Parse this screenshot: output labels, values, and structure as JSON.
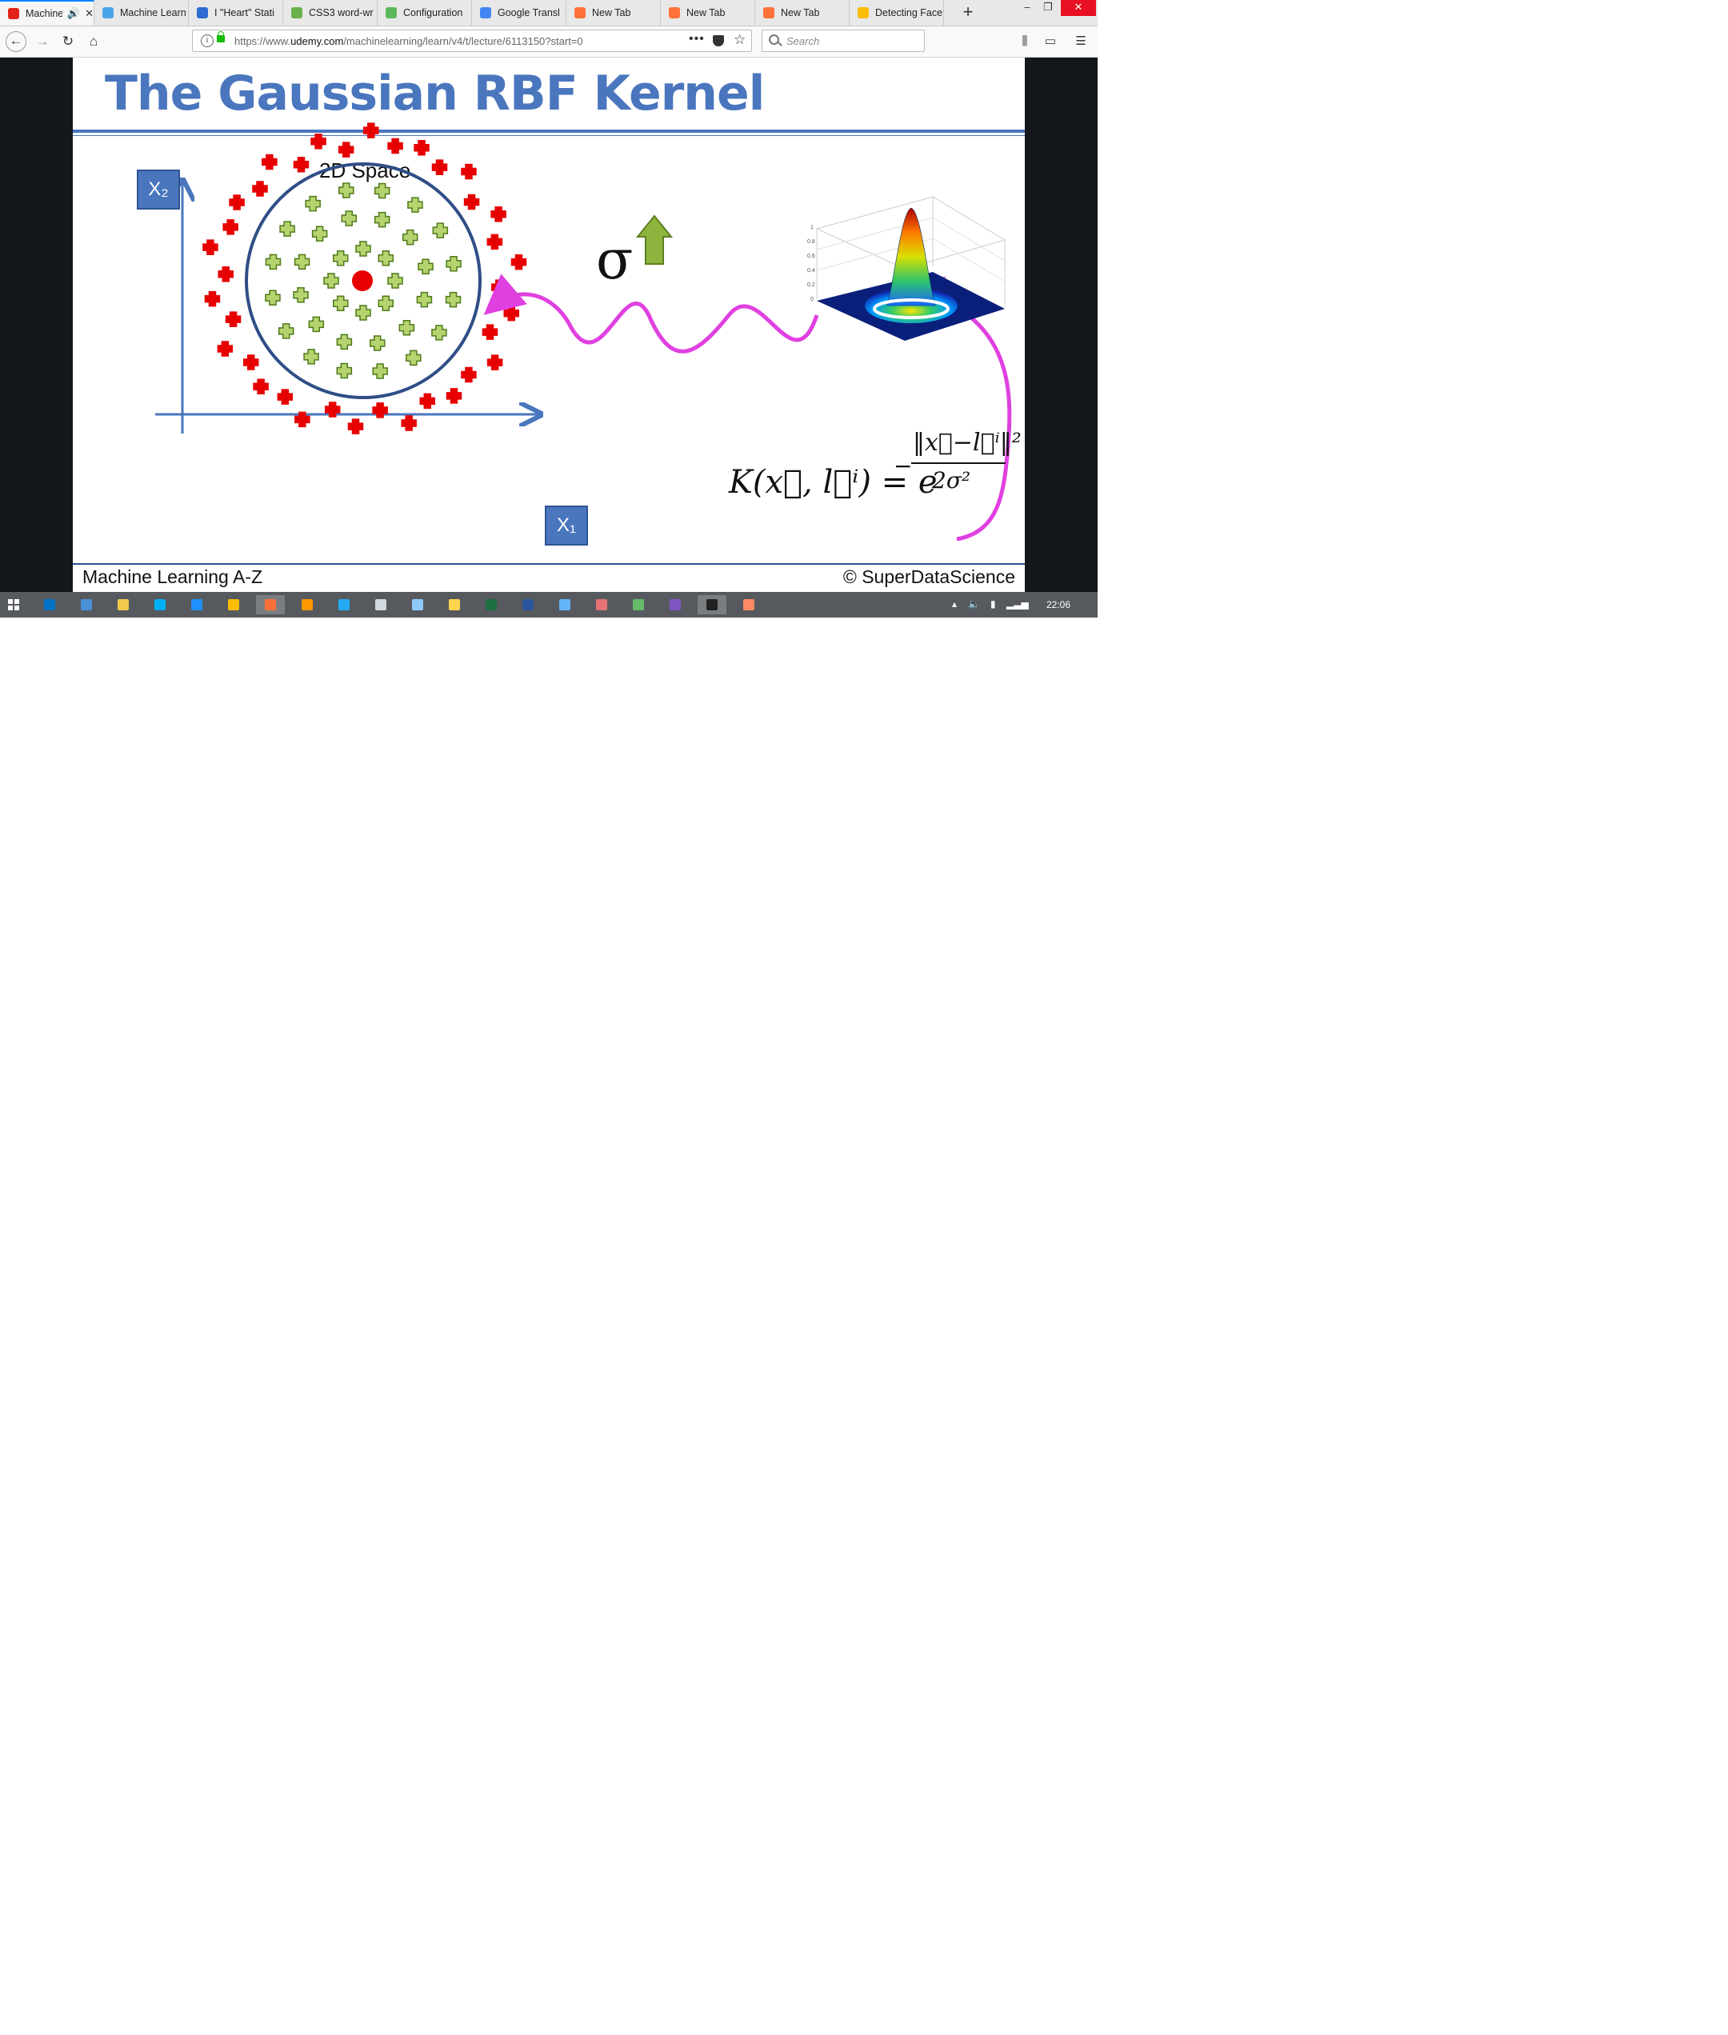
{
  "browser": {
    "tabs": [
      {
        "title": "Machine",
        "color": "#e2231a"
      },
      {
        "title": "Machine Learn",
        "color": "#4aa5e8"
      },
      {
        "title": "I \"Heart\" Stati",
        "color": "#2d6bd0"
      },
      {
        "title": "CSS3 word-wr",
        "color": "#6ab04c"
      },
      {
        "title": "Configuration",
        "color": "#5cb85c"
      },
      {
        "title": "Google Transl",
        "color": "#4285f4"
      },
      {
        "title": "New Tab",
        "color": "#ff7139"
      },
      {
        "title": "New Tab",
        "color": "#ff7139"
      },
      {
        "title": "New Tab",
        "color": "#ff7139"
      },
      {
        "title": "Detecting Face",
        "color": "#fbbc05"
      }
    ],
    "new_tab_label": "+",
    "window_controls": {
      "minimize": "–",
      "restore": "❐",
      "close": "✕"
    },
    "url_prefix": "https://www.",
    "url_domain": "udemy.com",
    "url_path": "/machinelearning/learn/v4/t/lecture/6113150?start=0",
    "search_placeholder": "Search"
  },
  "slide": {
    "title": "The Gaussian RBF Kernel",
    "space_label": "2D Space",
    "axis_x_label": "X₁",
    "axis_y_label": "X₂",
    "sigma_symbol": "σ",
    "formula_lhs": "K(x⃗, l⃗ⁱ) = e",
    "formula_minus": "−",
    "formula_numerator": "‖x⃗−l⃗ⁱ‖²",
    "formula_denominator": "2σ²",
    "plot_ticks_z": [
      "1",
      "0.8",
      "0.6",
      "0.4",
      "0.2",
      "0"
    ],
    "footer_left": "Machine Learning A-Z",
    "footer_right": "© SuperDataScience",
    "colors": {
      "accent": "#4a76be",
      "positive": "#e60000",
      "negative": "#8db43c",
      "arrow": "#e040e0"
    }
  },
  "taskbar": {
    "clock": "22:06",
    "apps": [
      "outlook",
      "remote-desktop",
      "file-explorer",
      "skype",
      "edge",
      "chrome",
      "firefox",
      "sublime",
      "vscode",
      "printer",
      "snipping",
      "paint",
      "excel",
      "word",
      "link",
      "mixer",
      "git",
      "visual-studio",
      "terminal",
      "chrome-dev"
    ]
  }
}
